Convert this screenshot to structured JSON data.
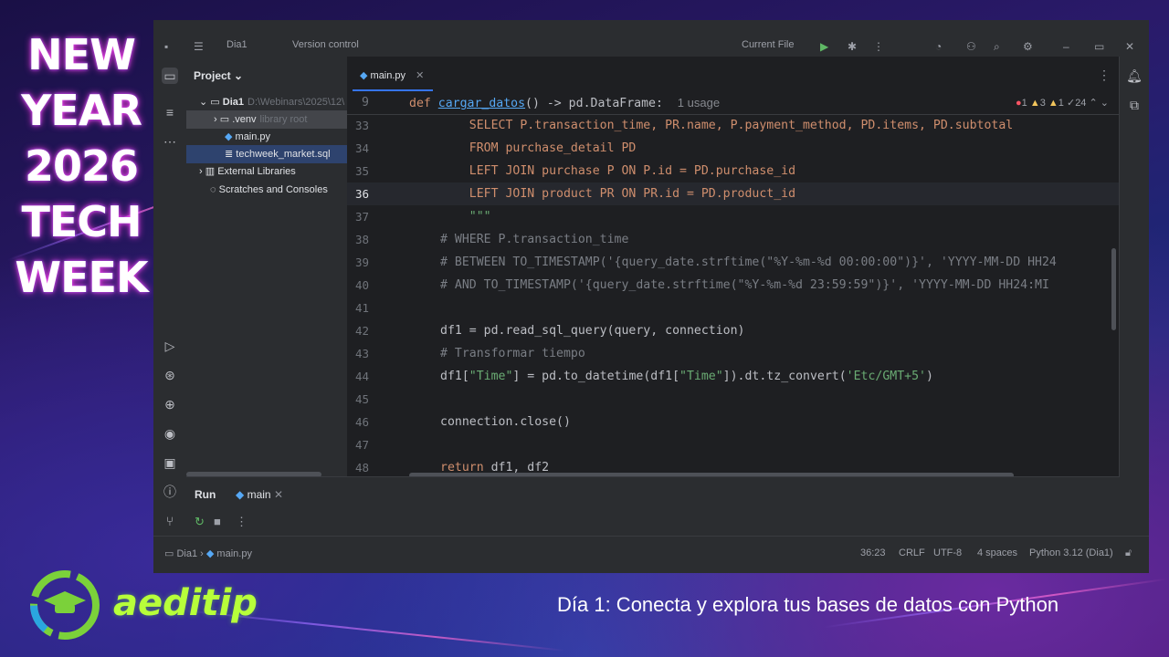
{
  "promo": {
    "lines": [
      "NEW",
      "YEAR",
      "2026",
      "TECH",
      "WEEK"
    ],
    "brand": "aeditip",
    "subtitle": "Día 1: Conecta y explora tus bases de datos con Python"
  },
  "titlebar": {
    "project": "Dia1",
    "vcs": "Version control",
    "run_config": "Current File"
  },
  "project_panel": {
    "title": "Project",
    "items": [
      {
        "label": "Dia1",
        "extra": "D:\\Webinars\\2025\\12\\"
      },
      {
        "label": ".venv",
        "extra": "library root"
      },
      {
        "label": "main.py",
        "extra": ""
      },
      {
        "label": "techweek_market.sql",
        "extra": ""
      },
      {
        "label": "External Libraries",
        "extra": ""
      },
      {
        "label": "Scratches and Consoles",
        "extra": ""
      }
    ]
  },
  "editor": {
    "tab": "main.py",
    "sticky": {
      "line": "9",
      "kw": "def ",
      "fn": "cargar_datos",
      "rest": "() -> pd.DataFrame:",
      "usage": "1 usage"
    },
    "inspections": {
      "errors": "1",
      "warnings": "3",
      "weak": "1",
      "typos": "24"
    },
    "lines": [
      {
        "n": "33",
        "parts": [
          [
            "sql",
            "    SELECT P.transaction_time, PR.name, P.payment_method, PD.items, PD.subtotal"
          ]
        ]
      },
      {
        "n": "34",
        "parts": [
          [
            "sql",
            "    FROM purchase_detail PD"
          ]
        ]
      },
      {
        "n": "35",
        "parts": [
          [
            "sql",
            "    LEFT JOIN purchase P ON P.id = PD.purchase_id"
          ]
        ]
      },
      {
        "n": "36",
        "parts": [
          [
            "sql",
            "    LEFT JOIN product PR ON PR.id = PD.product_id"
          ]
        ]
      },
      {
        "n": "37",
        "parts": [
          [
            "str",
            "    \"\"\""
          ]
        ]
      },
      {
        "n": "38",
        "parts": [
          [
            "cm",
            "# WHERE P.transaction_time"
          ]
        ]
      },
      {
        "n": "39",
        "parts": [
          [
            "cm",
            "# BETWEEN TO_TIMESTAMP('{query_date.strftime(\"%Y-%m-%d 00:00:00\")}', 'YYYY-MM-DD HH24"
          ]
        ]
      },
      {
        "n": "40",
        "parts": [
          [
            "cm",
            "# AND TO_TIMESTAMP('{query_date.strftime(\"%Y-%m-%d 23:59:59\")}', 'YYYY-MM-DD HH24:MI"
          ]
        ]
      },
      {
        "n": "41",
        "parts": []
      },
      {
        "n": "42",
        "parts": [
          [
            "txt",
            "df1 = pd.read_sql_query(query, connection)"
          ]
        ]
      },
      {
        "n": "43",
        "parts": [
          [
            "cm",
            "# Transformar tiempo"
          ]
        ]
      },
      {
        "n": "44",
        "parts": [
          [
            "txt",
            "df1["
          ],
          [
            "str",
            "\"Time\""
          ],
          [
            "txt",
            "] = pd.to_datetime(df1["
          ],
          [
            "str",
            "\"Time\""
          ],
          [
            "txt",
            "]).dt.tz_convert("
          ],
          [
            "str",
            "'Etc/GMT+5'"
          ],
          [
            "txt",
            ")"
          ]
        ]
      },
      {
        "n": "45",
        "parts": []
      },
      {
        "n": "46",
        "parts": [
          [
            "txt",
            "connection.close()"
          ]
        ]
      },
      {
        "n": "47",
        "parts": []
      },
      {
        "n": "48",
        "parts": [
          [
            "kw",
            "return "
          ],
          [
            "txt",
            "df1, df2"
          ]
        ]
      }
    ],
    "current_line": "36"
  },
  "run_panel": {
    "label": "Run",
    "tab": "main"
  },
  "statusbar": {
    "breadcrumb_project": "Dia1",
    "breadcrumb_file": "main.py",
    "position": "36:23",
    "line_sep": "CRLF",
    "encoding": "UTF-8",
    "indent": "4 spaces",
    "interpreter": "Python 3.12 (Dia1)"
  }
}
